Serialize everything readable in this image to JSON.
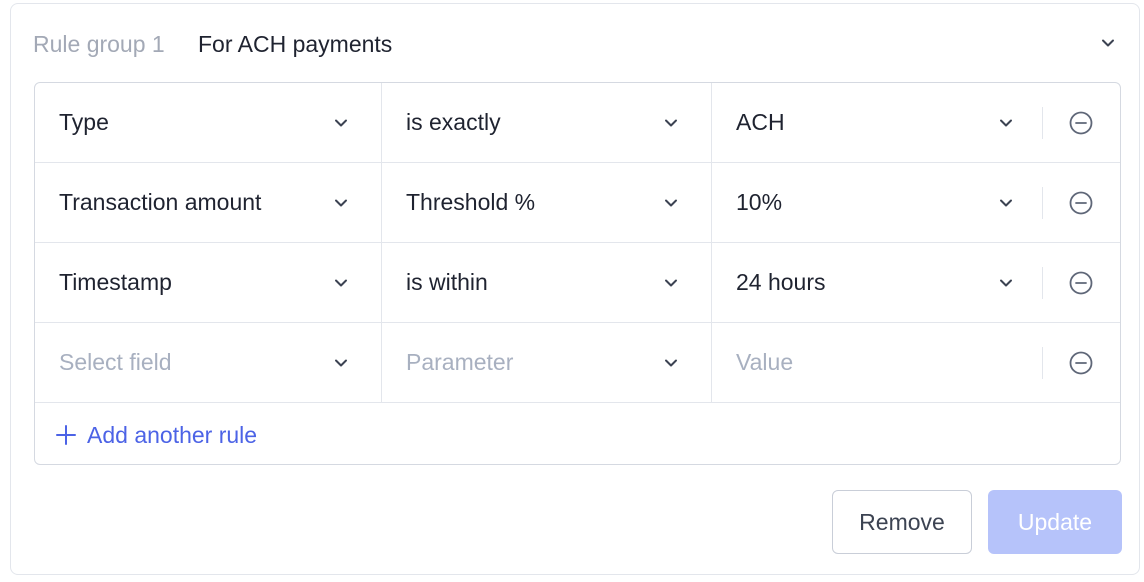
{
  "header": {
    "group_label": "Rule group 1",
    "group_title": "For ACH payments"
  },
  "rules": [
    {
      "field": "Type",
      "parameter": "is exactly",
      "value": "ACH"
    },
    {
      "field": "Transaction amount",
      "parameter": "Threshold %",
      "value": "10%"
    },
    {
      "field": "Timestamp",
      "parameter": "is within",
      "value": "24 hours"
    },
    {
      "field_placeholder": "Select field",
      "parameter_placeholder": "Parameter",
      "value_placeholder": "Value"
    }
  ],
  "add_rule_label": "Add another rule",
  "actions": {
    "remove_label": "Remove",
    "update_label": "Update",
    "update_disabled": true
  },
  "colors": {
    "accent": "#4c63e6",
    "update_disabled_bg": "#b6c3fa",
    "placeholder_text": "#a8b0c0",
    "border": "#d5d9e1"
  },
  "icons": {
    "collapse": "chevron-down-icon",
    "select": "chevron-down-icon",
    "remove_rule": "minus-circle-icon",
    "add": "plus-icon"
  }
}
